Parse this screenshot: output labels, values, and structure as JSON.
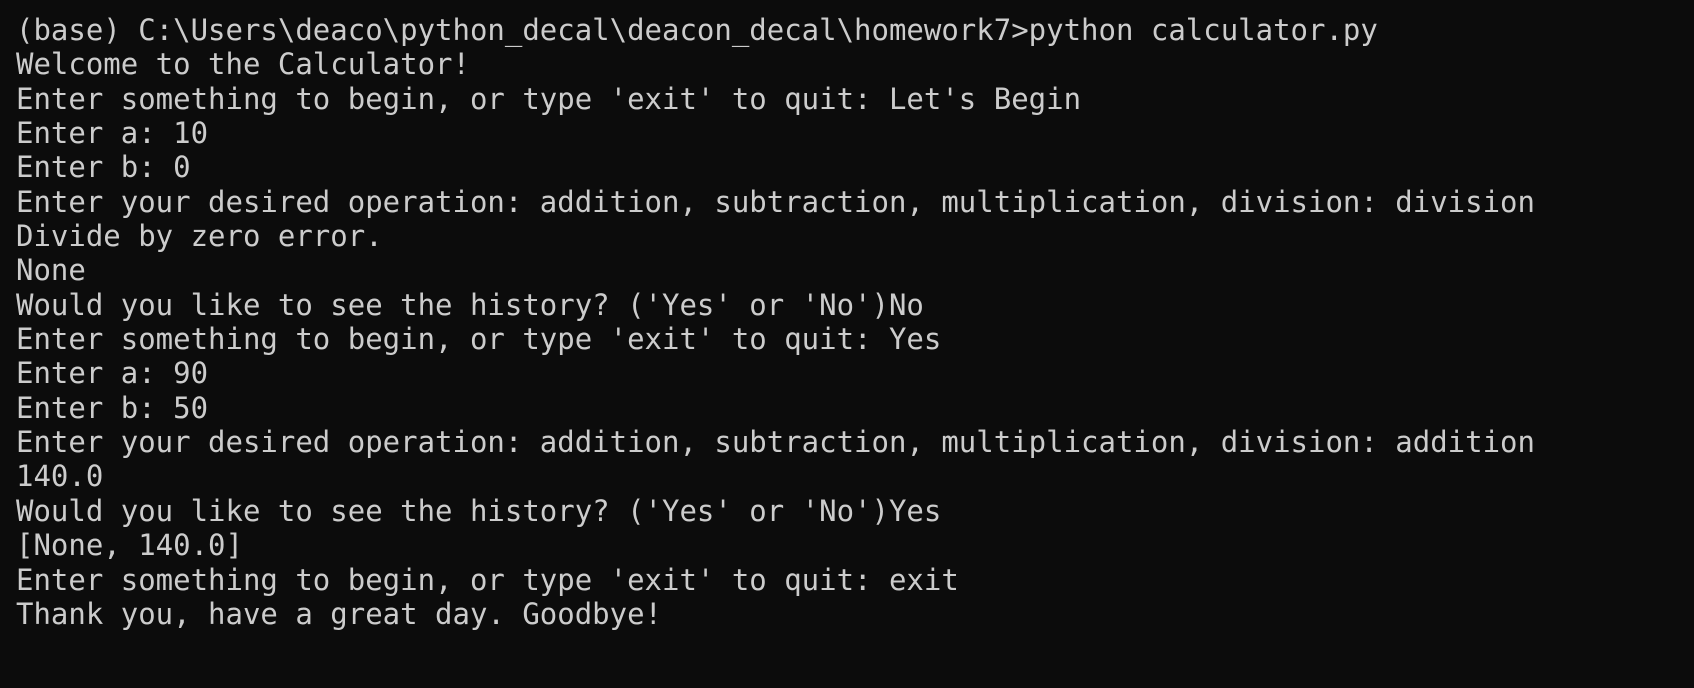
{
  "colors": {
    "background": "#0c0c0c",
    "text": "#cccccc"
  },
  "lines": [
    "(base) C:\\Users\\deaco\\python_decal\\deacon_decal\\homework7>python calculator.py",
    "Welcome to the Calculator!",
    "Enter something to begin, or type 'exit' to quit: Let's Begin",
    "Enter a: 10",
    "Enter b: 0",
    "Enter your desired operation: addition, subtraction, multiplication, division: division",
    "Divide by zero error.",
    "None",
    "Would you like to see the history? ('Yes' or 'No')No",
    "Enter something to begin, or type 'exit' to quit: Yes",
    "Enter a: 90",
    "Enter b: 50",
    "Enter your desired operation: addition, subtraction, multiplication, division: addition",
    "140.0",
    "Would you like to see the history? ('Yes' or 'No')Yes",
    "[None, 140.0]",
    "Enter something to begin, or type 'exit' to quit: exit",
    "Thank you, have a great day. Goodbye!"
  ]
}
